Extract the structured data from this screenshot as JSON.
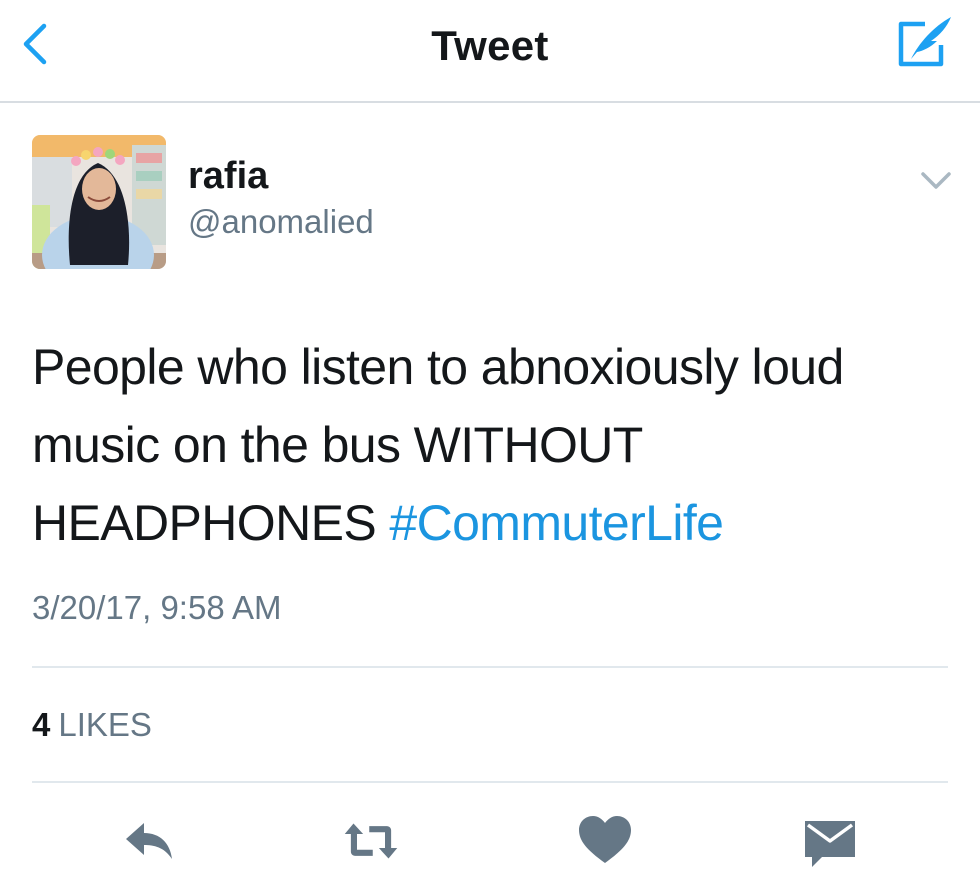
{
  "nav": {
    "title": "Tweet",
    "back_icon": "chevron-left-icon",
    "compose_icon": "compose-tweet-icon",
    "accent_color": "#1da1f2"
  },
  "tweet": {
    "author": {
      "display_name": "rafia",
      "handle": "@anomalied"
    },
    "text": "People who listen to abnoxiously loud music on the bus WITHOUT HEADPHONES",
    "hashtag": "#CommuterLife",
    "timestamp": "3/20/17, 9:58 AM",
    "stats": {
      "likes_count": "4",
      "likes_label": "LIKES"
    }
  },
  "actions": [
    {
      "name": "reply",
      "icon": "reply-icon"
    },
    {
      "name": "retweet",
      "icon": "retweet-icon"
    },
    {
      "name": "like",
      "icon": "heart-icon"
    },
    {
      "name": "direct-message",
      "icon": "envelope-icon"
    }
  ],
  "colors": {
    "text_primary": "#14171a",
    "text_secondary": "#657786",
    "link": "#1b95e0",
    "icon_gray": "#657786",
    "divider": "#e1e8ed"
  }
}
